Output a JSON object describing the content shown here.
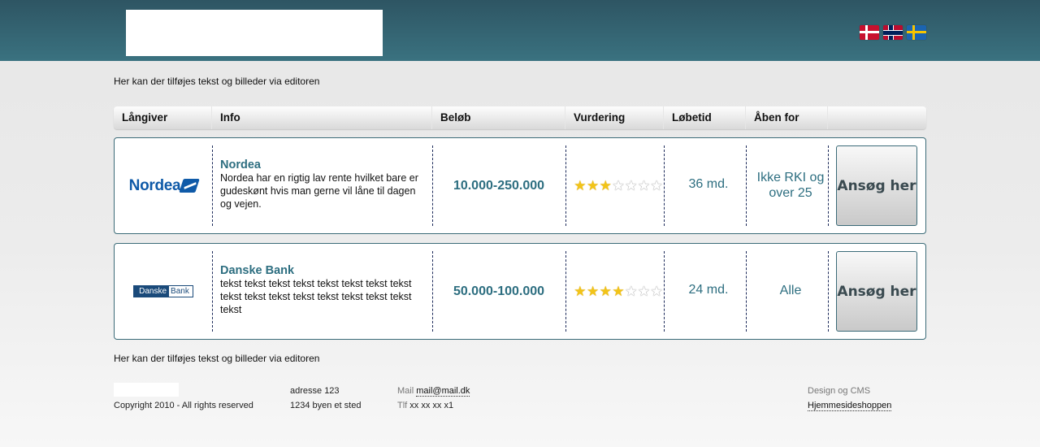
{
  "header": {
    "flags": [
      "Danish flag",
      "Norwegian flag",
      "Swedish flag"
    ]
  },
  "intro_top": "Her kan der tilføjes tekst og billeder via editoren",
  "intro_bottom": "Her kan der tilføjes tekst og billeder via editoren",
  "table": {
    "columns": [
      "Långiver",
      "Info",
      "Beløb",
      "Vurdering",
      "Løbetid",
      "Åben for"
    ],
    "rows": [
      {
        "logo_text": "Nordea",
        "name": "Nordea",
        "description": "Nordea har en rigtig lav rente hvilket bare er gudeskønt hvis man gerne vil låne til dagen og vejen.",
        "amount": "10.000-250.000",
        "rating": 3,
        "rating_max": 7,
        "term": "36 md.",
        "open_for": "Ikke RKI og over 25",
        "button": "Ansøg her"
      },
      {
        "logo_text_1": "Danske",
        "logo_text_2": "Bank",
        "name": "Danske Bank",
        "description": "tekst tekst tekst tekst tekst tekst tekst tekst tekst tekst tekst tekst tekst tekst tekst tekst tekst",
        "amount": "50.000-100.000",
        "rating": 4,
        "rating_max": 7,
        "term": "24 md.",
        "open_for": "Alle",
        "button": "Ansøg her"
      }
    ]
  },
  "footer": {
    "copyright": "Copyright 2010 - All rights reserved",
    "address_1": "adresse 123",
    "address_2": "1234 byen et sted",
    "mail_label": "Mail",
    "mail_value": "mail@mail.dk",
    "phone_label": "Tlf",
    "phone_value": "xx xx xx x1",
    "design_label": "Design og CMS",
    "design_link": "Hjemmesideshoppen"
  },
  "colors": {
    "header": "#2e5563",
    "accent": "#2d6e80",
    "star": "#f2c418"
  }
}
